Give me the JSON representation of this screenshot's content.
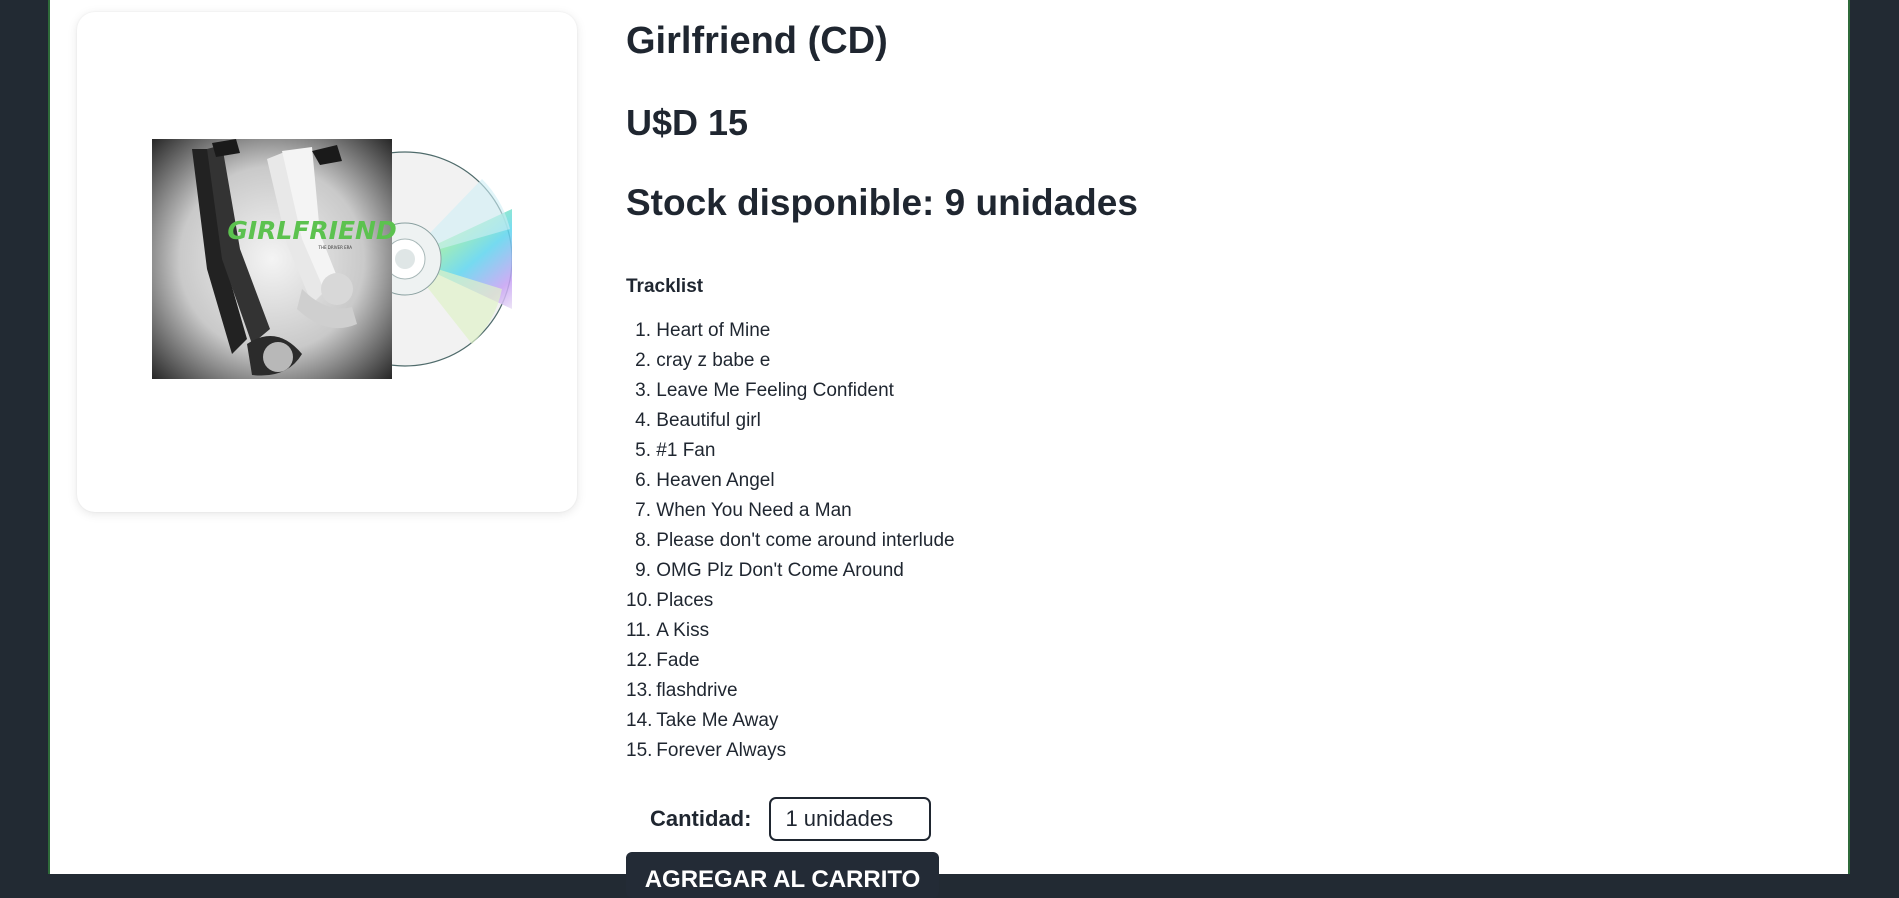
{
  "product": {
    "title": "Girlfriend (CD)",
    "price": "U$D 15",
    "stock": "Stock disponible: 9 unidades",
    "cover_text": "GIRLFRIEND",
    "cover_subtext": "THE DRIVER ERA"
  },
  "tracklist": {
    "heading": "Tracklist",
    "tracks": [
      {
        "num": "1.",
        "title": "Heart of Mine"
      },
      {
        "num": "2.",
        "title": "cray z babe e"
      },
      {
        "num": "3.",
        "title": "Leave Me Feeling Confident"
      },
      {
        "num": "4.",
        "title": "Beautiful girl"
      },
      {
        "num": "5.",
        "title": "#1 Fan"
      },
      {
        "num": "6.",
        "title": "Heaven Angel"
      },
      {
        "num": "7.",
        "title": "When You Need a Man"
      },
      {
        "num": "8.",
        "title": "Please don't come around interlude"
      },
      {
        "num": "9.",
        "title": "OMG Plz Don't Come Around"
      },
      {
        "num": "10.",
        "title": "Places"
      },
      {
        "num": "11.",
        "title": "A Kiss"
      },
      {
        "num": "12.",
        "title": "Fade"
      },
      {
        "num": "13.",
        "title": "flashdrive"
      },
      {
        "num": "14.",
        "title": "Take Me Away"
      },
      {
        "num": "15.",
        "title": "Forever Always"
      }
    ]
  },
  "purchase": {
    "quantity_label": "Cantidad:",
    "quantity_value": "1 unidades",
    "add_button_label": "AGREGAR AL CARRITO"
  },
  "colors": {
    "page_background": "#222a33",
    "content_background": "#ffffff",
    "text": "#1f2630",
    "button": "#232b36",
    "cover_title_green": "#5cc24f",
    "frame_border_green": "#2f6b3a"
  }
}
